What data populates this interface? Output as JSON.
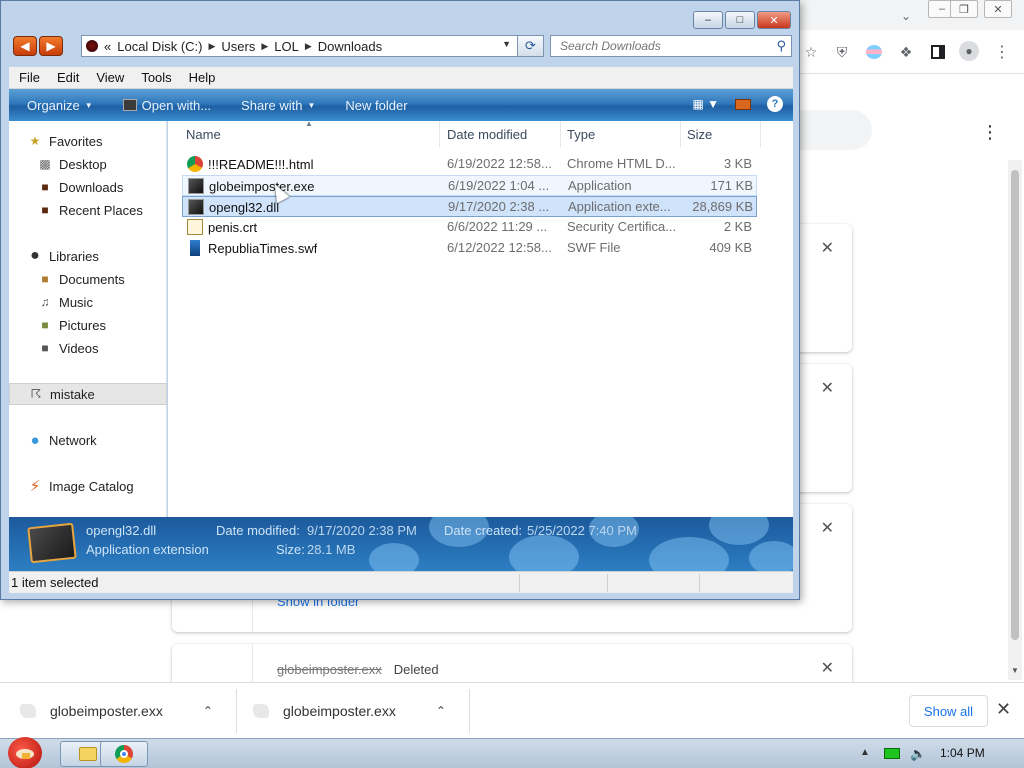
{
  "chrome": {
    "downloads": [
      {
        "name": "globeimposter.exx",
        "status": "Deleted"
      }
    ],
    "show_in_folder": "Show in folder",
    "shelf": [
      {
        "name": "globeimposter.exx"
      },
      {
        "name": "globeimposter.exx"
      }
    ],
    "show_all": "Show all",
    "icons": {
      "ublock": "ublock-origin-icon",
      "extensions": "puzzle-icon",
      "sidepanel": "side-panel-icon",
      "profile": "profile-icon",
      "menu": "kebab-menu-icon"
    },
    "win_controls": [
      "minimize",
      "restore",
      "close"
    ]
  },
  "explorer": {
    "address": {
      "overflow": "«",
      "segments": [
        "Local Disk (C:)",
        "Users",
        "LOL",
        "Downloads"
      ]
    },
    "search_placeholder": "Search Downloads",
    "menu": [
      "File",
      "Edit",
      "View",
      "Tools",
      "Help"
    ],
    "commands": {
      "organize": "Organize",
      "open_with": "Open with...",
      "share_with": "Share with",
      "new_folder": "New folder"
    },
    "nav": {
      "favorites": "Favorites",
      "desktop": "Desktop",
      "downloads": "Downloads",
      "recent": "Recent Places",
      "libraries": "Libraries",
      "documents": "Documents",
      "music": "Music",
      "pictures": "Pictures",
      "videos": "Videos",
      "mistake": "mistake",
      "network": "Network",
      "image_catalog": "Image Catalog"
    },
    "columns": {
      "name": "Name",
      "date": "Date modified",
      "type": "Type",
      "size": "Size"
    },
    "files": [
      {
        "name": "!!!README!!!.html",
        "date": "6/19/2022 12:58...",
        "type": "Chrome HTML D...",
        "size": "3 KB",
        "icon": "chrome-html-icon"
      },
      {
        "name": "globeimposter.exe",
        "date": "6/19/2022 1:04 ...",
        "type": "Application",
        "size": "171 KB",
        "icon": "application-icon"
      },
      {
        "name": "opengl32.dll",
        "date": "9/17/2020 2:38 ...",
        "type": "Application exte...",
        "size": "28,869 KB",
        "icon": "dll-icon"
      },
      {
        "name": "penis.crt",
        "date": "6/6/2022 11:29 ...",
        "type": "Security Certifica...",
        "size": "2 KB",
        "icon": "certificate-icon"
      },
      {
        "name": "RepubliaTimes.swf",
        "date": "6/12/2022 12:58...",
        "type": "SWF File",
        "size": "409 KB",
        "icon": "swf-icon"
      }
    ],
    "details": {
      "name": "opengl32.dll",
      "type": "Application extension",
      "modified_label": "Date modified:",
      "modified_value": "9/17/2020 2:38 PM",
      "created_label": "Date created:",
      "created_value": "5/25/2022 7:40 PM",
      "size_label": "Size:",
      "size_value": "28.1 MB"
    },
    "status": "1 item selected"
  },
  "taskbar": {
    "clock": "1:04 PM"
  }
}
